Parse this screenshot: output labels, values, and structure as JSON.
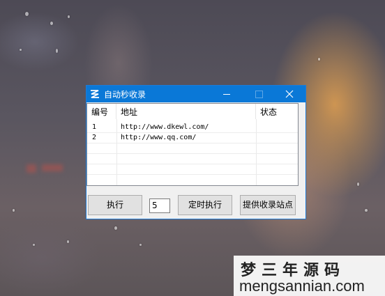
{
  "window": {
    "title": "自动秒收录",
    "minimize_glyph": "—",
    "maximize_glyph": "☐",
    "close_glyph": "✕"
  },
  "list": {
    "columns": [
      "编号",
      "地址",
      "状态"
    ],
    "rows": [
      {
        "num": "1",
        "url": "http://www.dkewl.com/",
        "status": ""
      },
      {
        "num": "2",
        "url": "http://www.qq.com/",
        "status": ""
      }
    ]
  },
  "controls": {
    "execute_label": "执行",
    "interval_value": "5",
    "timed_execute_label": "定时执行",
    "submit_sites_label": "提供收录站点"
  },
  "watermark": {
    "cn": "梦三年源码",
    "en": "mengsannian.com"
  },
  "colors": {
    "titlebar": "#0a78d7",
    "window_border": "#1e7bd6"
  }
}
